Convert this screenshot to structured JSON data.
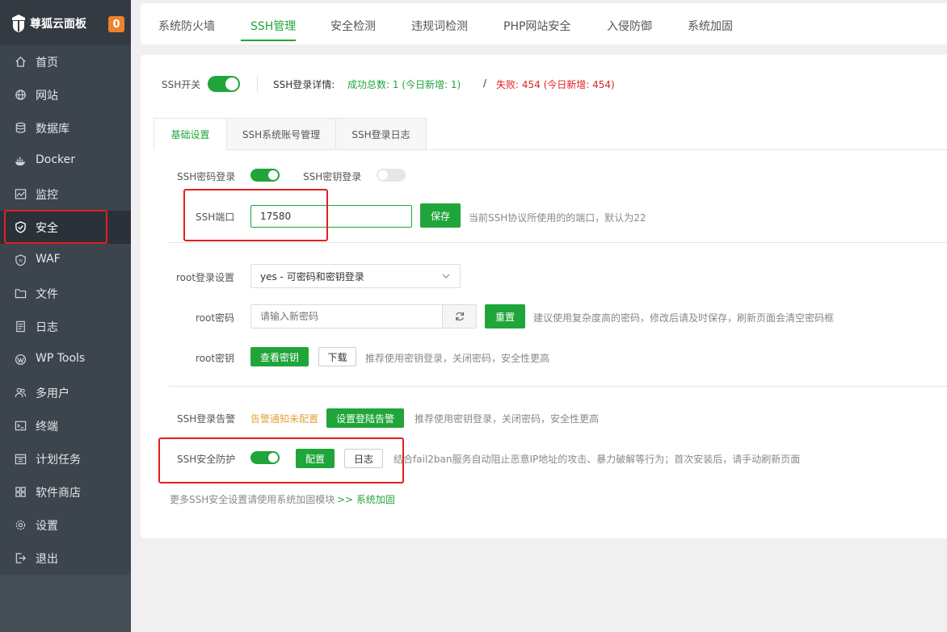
{
  "app": {
    "title": "尊狐云面板",
    "badge_count": "0"
  },
  "colors": {
    "accent": "#20a53a",
    "sidebar_bg": "#3c444d",
    "danger": "#e02020",
    "warning": "#e6a23c",
    "badge": "#f0812c"
  },
  "sidebar": {
    "items": [
      {
        "label": "首页",
        "icon": "home-icon"
      },
      {
        "label": "网站",
        "icon": "globe-icon"
      },
      {
        "label": "数据库",
        "icon": "database-icon"
      },
      {
        "label": "Docker",
        "icon": "docker-icon"
      },
      {
        "label": "监控",
        "icon": "monitor-icon"
      },
      {
        "label": "安全",
        "icon": "shield-icon",
        "active": true
      },
      {
        "label": "WAF",
        "icon": "waf-icon"
      },
      {
        "label": "文件",
        "icon": "folder-icon"
      },
      {
        "label": "日志",
        "icon": "log-icon"
      },
      {
        "label": "WP Tools",
        "icon": "wordpress-icon"
      },
      {
        "label": "多用户",
        "icon": "users-icon"
      },
      {
        "label": "终端",
        "icon": "terminal-icon"
      },
      {
        "label": "计划任务",
        "icon": "calendar-icon"
      },
      {
        "label": "软件商店",
        "icon": "apps-icon"
      },
      {
        "label": "设置",
        "icon": "gear-icon"
      },
      {
        "label": "退出",
        "icon": "logout-icon"
      }
    ]
  },
  "top_tabs": [
    "系统防火墙",
    "SSH管理",
    "安全检测",
    "违规词检测",
    "PHP网站安全",
    "入侵防御",
    "系统加固"
  ],
  "top_tab_active": "SSH管理",
  "ssh_header": {
    "switch_label": "SSH开关",
    "switch_on": true,
    "detail_label": "SSH登录详情:",
    "success_text": "成功总数: 1 (今日新增: 1)",
    "separator": "/",
    "fail_text": "失败: 454 (今日新增: 454)"
  },
  "inner_tabs": [
    "基础设置",
    "SSH系统账号管理",
    "SSH登录日志"
  ],
  "inner_tab_active": "基础设置",
  "basic": {
    "pwd_login_label": "SSH密码登录",
    "pwd_login_on": true,
    "key_login_label": "SSH密钥登录",
    "key_login_on": false,
    "port_label": "SSH端口",
    "port_value": "17580",
    "save_label": "保存",
    "port_hint": "当前SSH协议所使用的的端口，默认为22",
    "root_login_label": "root登录设置",
    "root_login_value": "yes - 可密码和密钥登录",
    "root_pwd_label": "root密码",
    "root_pwd_placeholder": "请输入新密码",
    "reset_label": "重置",
    "root_pwd_hint": "建议使用复杂度高的密码，修改后请及时保存，刷新页面会清空密码框",
    "root_key_label": "root密钥",
    "view_key_label": "查看密钥",
    "download_label": "下载",
    "root_key_hint": "推荐使用密钥登录，关闭密码，安全性更高",
    "alarm_label": "SSH登录告警",
    "alarm_status": "告警通知未配置",
    "alarm_button": "设置登陆告警",
    "alarm_hint": "推荐使用密钥登录，关闭密码，安全性更高",
    "protect_label": "SSH安全防护",
    "protect_on": true,
    "config_label": "配置",
    "log_label": "日志",
    "protect_hint": "结合fail2ban服务自动阻止恶意IP地址的攻击、暴力破解等行为；首次安装后，请手动刷新页面",
    "more_text": "更多SSH安全设置请使用系统加固模块",
    "more_link": ">> 系统加固"
  }
}
